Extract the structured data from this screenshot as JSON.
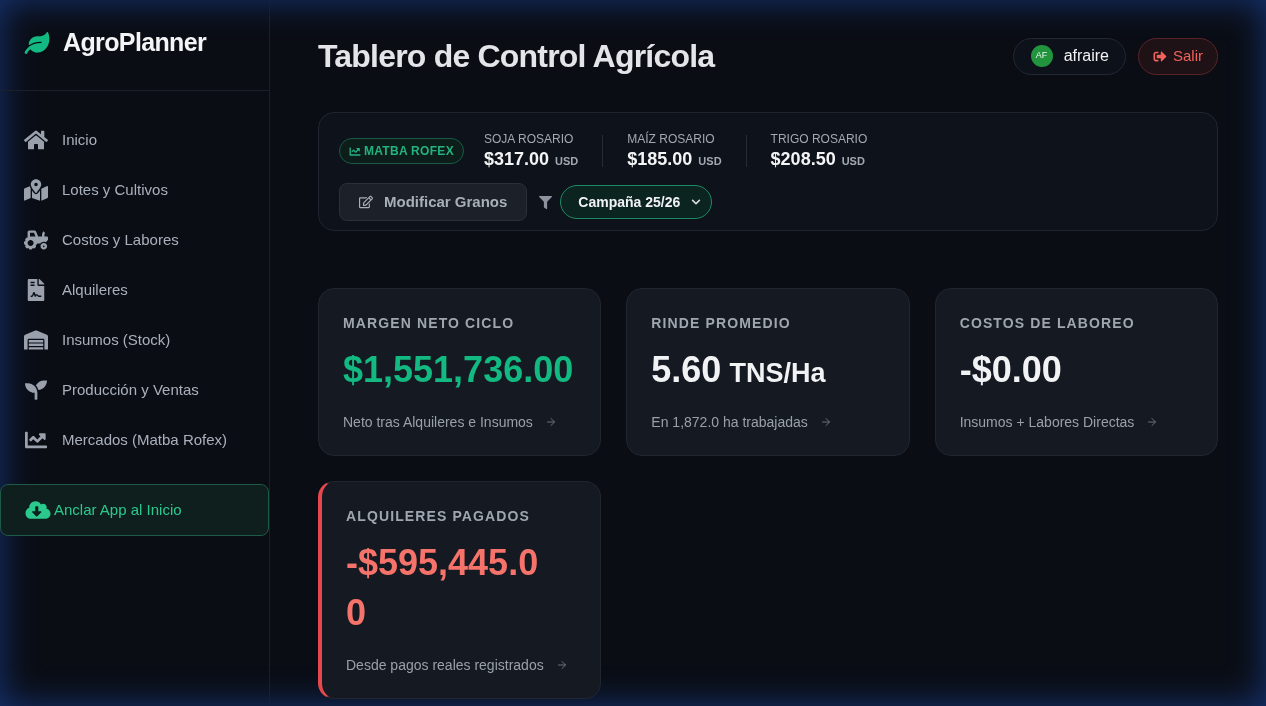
{
  "sidebar": {
    "brand": "AgroPlanner",
    "items": [
      {
        "label": "Inicio"
      },
      {
        "label": "Lotes y Cultivos"
      },
      {
        "label": "Costos y Labores"
      },
      {
        "label": "Alquileres"
      },
      {
        "label": "Insumos (Stock)"
      },
      {
        "label": "Producción y Ventas"
      },
      {
        "label": "Mercados (Matba Rofex)"
      }
    ],
    "install_button": "Anclar App al Inicio"
  },
  "header": {
    "title": "Tablero de Control Agrícola",
    "user": {
      "initials": "AF",
      "name": "afraire"
    },
    "logout_button": "Salir"
  },
  "market": {
    "source": "MATBA ROFEX",
    "prices": [
      {
        "label": "SOJA ROSARIO",
        "value": "$317.00",
        "unit": "USD"
      },
      {
        "label": "MAÍZ ROSARIO",
        "value": "$185.00",
        "unit": "USD"
      },
      {
        "label": "TRIGO ROSARIO",
        "value": "$208.50",
        "unit": "USD"
      }
    ],
    "edit_button": "Modificar Granos",
    "campaign_select": {
      "value": "Campaña 25/26"
    }
  },
  "cards": [
    {
      "title": "MARGEN NETO CICLO",
      "value": "$1,551,736.00",
      "color": "#12b981",
      "note": "Neto tras Alquileres e Insumos",
      "alert": false
    },
    {
      "title": "RINDE PROMEDIO",
      "value": "5.60",
      "unit": "TNS/Ha",
      "color": "#f1f2f4",
      "note": "En 1,872.0 ha trabajadas",
      "alert": false
    },
    {
      "title": "COSTOS DE LABOREO",
      "value": "-$0.00",
      "color": "#f1f2f4",
      "note": "Insumos + Labores Directas",
      "alert": false
    },
    {
      "title": "ALQUILERES PAGADOS",
      "value": "-$595,445.00",
      "color": "#f5736a",
      "note": "Desde pagos reales registrados",
      "alert": true
    }
  ]
}
